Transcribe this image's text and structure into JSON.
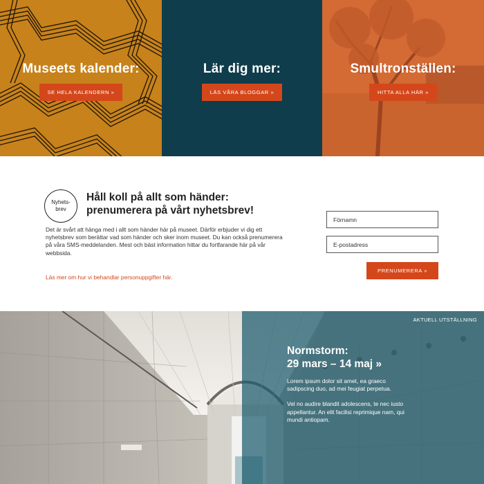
{
  "tiles": [
    {
      "heading": "Museets kalender:",
      "button": "SE HELA KALENDERN  »"
    },
    {
      "heading": "Lär dig mer:",
      "button": "LÄS VÅRA  BLOGGAR  »"
    },
    {
      "heading": "Smultronställen:",
      "button": "HITTA ALLA HÄR  »"
    }
  ],
  "newsletter": {
    "badge": "Nyhets-\nbrev",
    "title_line1": "Håll koll på allt som händer:",
    "title_line2": "prenumerera på vårt nyhetsbrev!",
    "body": "Det är svårt att hänga med i allt som händer här på museet. Därför erbjuder vi dig ett nyhetsbrev som berättar vad som händer och sker inom museet. Du kan också prenumerera på våra SMS-meddelanden. Mest och bäst information hittar du fortfarande här på vår webbsida.",
    "privacy_link": "Läs mer om hur vi behandlar personuppgifter här.",
    "first_name_placeholder": "Förnamn",
    "email_placeholder": "E-postadress",
    "subscribe": "PRENUMERERA  »"
  },
  "exhibition": {
    "label": "AKTUELL UTSTÄLLNING",
    "title": "Normstorm:",
    "dates": "29 mars – 14 maj »",
    "para1": "Lorem ipsum dolor sit amet, ea graeco sadipscing duo, ad mei feugiat perpetua.",
    "para2": "Vel no audire blandit adolescens, te nec iusto appellantur. An elit facilisi reprimique nam, qui mundi antiopam."
  },
  "colors": {
    "accent": "#d4471b",
    "tile_calendar": "#c7821b",
    "tile_learn": "#0f3d4c",
    "tile_places": "#d46a34",
    "exhibition_overlay": "#1c5c6e"
  }
}
